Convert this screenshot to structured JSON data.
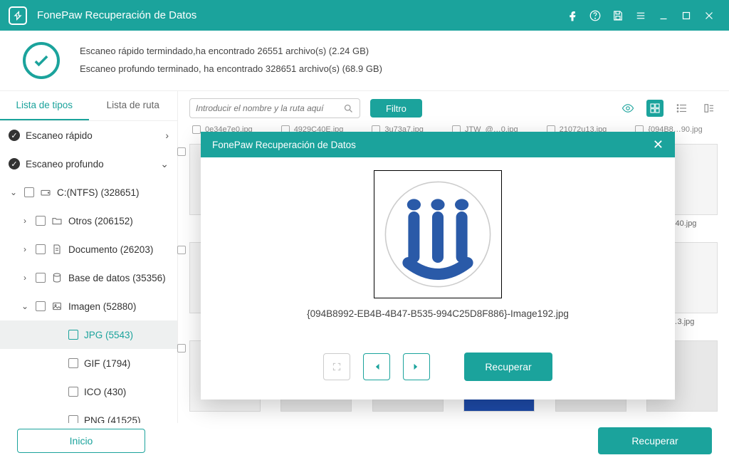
{
  "titlebar": {
    "app_name": "FonePaw Recuperación de Datos"
  },
  "summary": {
    "line1": "Escaneo rápido termindado,ha encontrado 26551 archivo(s) (2.24 GB)",
    "line2": "Escaneo profundo terminado, ha encontrado 328651 archivo(s) (68.9 GB)"
  },
  "sidebar": {
    "tabs": {
      "types": "Lista de tipos",
      "path": "Lista de ruta"
    },
    "sections": {
      "quick": "Escaneo rápido",
      "deep": "Escaneo profundo"
    },
    "tree": {
      "drive": "C:(NTFS) (328651)",
      "otros": "Otros (206152)",
      "documento": "Documento (26203)",
      "basedatos": "Base de datos (35356)",
      "imagen": "Imagen (52880)",
      "jpg": "JPG (5543)",
      "gif": "GIF (1794)",
      "ico": "ICO (430)",
      "png": "PNG (41525)"
    }
  },
  "toolbar": {
    "search_placeholder": "Introducir el nombre y la ruta aquí",
    "filter_label": "Filtro"
  },
  "filename_hints": {
    "a": "0e34e7e0.jpg",
    "b": "4929C40E.jpg",
    "c": "3u73a7.jpg",
    "d": "JTW_@…0.jpg",
    "e": "21072u13.jpg",
    "f": "{094B8…90.jpg"
  },
  "visible_thumbs": {
    "r1right": "…40.jpg",
    "r2right": "…3.jpg"
  },
  "footer": {
    "home": "Inicio",
    "recover": "Recuperar"
  },
  "modal": {
    "title": "FonePaw Recuperación de Datos",
    "filename": "{094B8992-EB4B-4B47-B535-994C25D8F886}-Image192.jpg",
    "recover": "Recuperar"
  }
}
